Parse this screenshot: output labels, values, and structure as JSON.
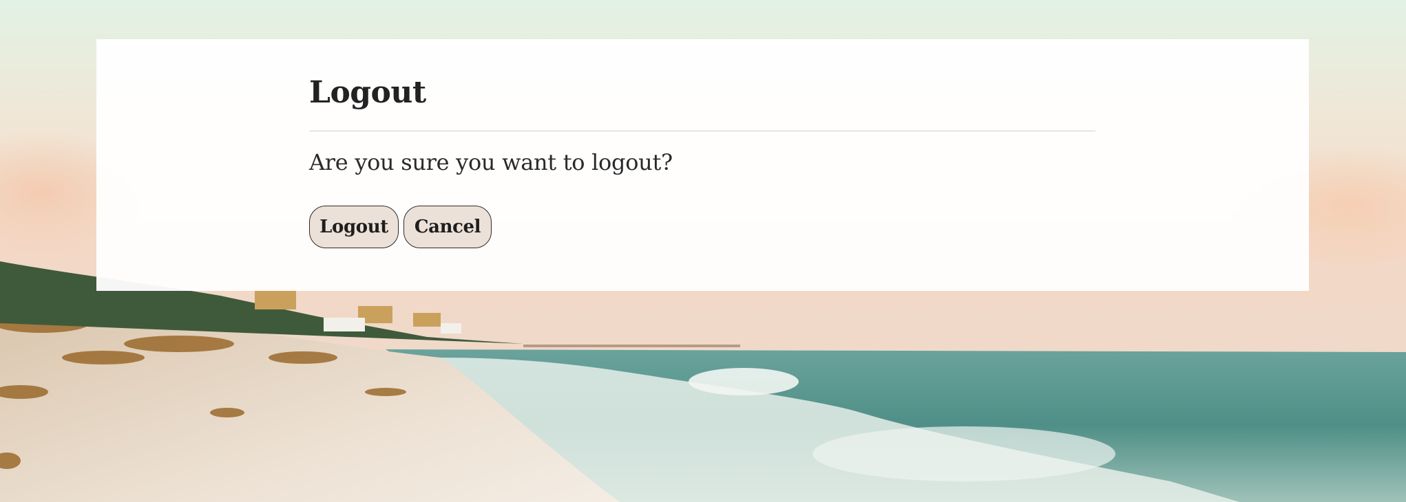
{
  "dialog": {
    "title": "Logout",
    "message": "Are you sure you want to logout?",
    "buttons": {
      "confirm_label": "Logout",
      "cancel_label": "Cancel"
    }
  },
  "background": {
    "description_icon": "beach-scene",
    "colors": {
      "sky_top": "#e3f2e6",
      "sky_warm": "#f3d9c6",
      "sea": "#5e9d95",
      "sand": "#e9dccd"
    }
  },
  "colors": {
    "card_bg": "#ffffff",
    "button_bg": "#ece1d8",
    "text": "#222222"
  }
}
